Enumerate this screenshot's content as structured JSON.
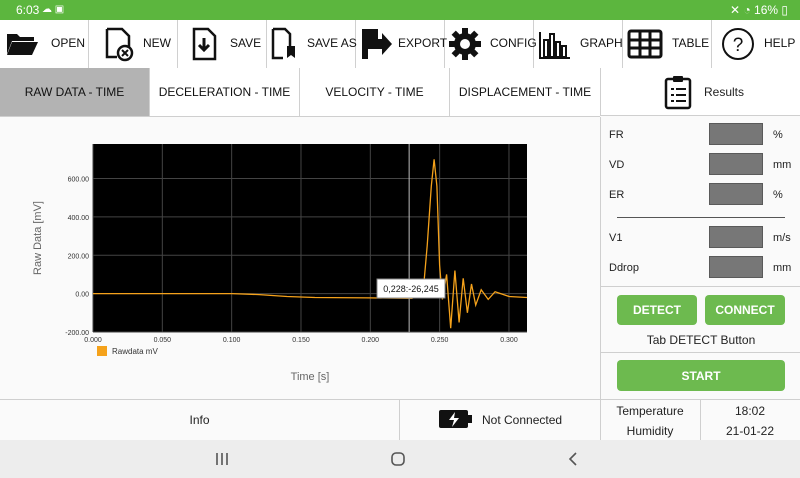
{
  "status_bar": {
    "time": "6:03",
    "battery": "16%"
  },
  "toolbar": [
    {
      "label": "OPEN",
      "icon": "folder-icon"
    },
    {
      "label": "NEW",
      "icon": "new-file-icon"
    },
    {
      "label": "SAVE",
      "icon": "save-icon"
    },
    {
      "label": "SAVE AS",
      "icon": "save-as-icon"
    },
    {
      "label": "EXPORT",
      "icon": "export-icon"
    },
    {
      "label": "CONFIG",
      "icon": "gear-icon"
    },
    {
      "label": "GRAPH",
      "icon": "bar-graph-icon"
    },
    {
      "label": "TABLE",
      "icon": "table-icon"
    },
    {
      "label": "HELP",
      "icon": "help-icon"
    }
  ],
  "tabs": [
    {
      "label": "RAW DATA - TIME",
      "active": true
    },
    {
      "label": "DECELERATION - TIME",
      "active": false
    },
    {
      "label": "VELOCITY - TIME",
      "active": false
    },
    {
      "label": "DISPLACEMENT - TIME",
      "active": false
    }
  ],
  "results": {
    "title": "Results",
    "fields": [
      {
        "key": "FR",
        "unit": "%",
        "value": ""
      },
      {
        "key": "VD",
        "unit": "mm",
        "value": ""
      },
      {
        "key": "ER",
        "unit": "%",
        "value": ""
      },
      {
        "key": "V1",
        "unit": "m/s",
        "value": ""
      },
      {
        "key": "Ddrop",
        "unit": "mm",
        "value": ""
      }
    ],
    "detect_label": "DETECT",
    "connect_label": "CONNECT",
    "hint": "Tab DETECT Button",
    "start_label": "START"
  },
  "bottom": {
    "info": "Info",
    "connection": "Not Connected",
    "temperature_label": "Temperature",
    "temperature_value": "18:02",
    "humidity_label": "Humidity",
    "humidity_value": "21-01-22"
  },
  "colors": {
    "accent": "#5cb63e",
    "button": "#6dba4f",
    "series": "#f5a21b",
    "plot_bg": "#000000"
  },
  "chart_data": {
    "type": "line",
    "xlabel": "Time [s]",
    "ylabel": "Raw Data [mV]",
    "xlim": [
      0.0,
      0.313
    ],
    "ylim": [
      -200,
      780
    ],
    "xticks": [
      "0.000",
      "0.050",
      "0.100",
      "0.150",
      "0.200",
      "0.250",
      "0.300"
    ],
    "yticks": [
      "-200.00",
      "0.00",
      "200.00",
      "400.00",
      "600.00"
    ],
    "grid": true,
    "legend": "bottom-left",
    "tooltip": "0,228:-26,245",
    "series": [
      {
        "name": "Rawdata mV",
        "x": [
          0.0,
          0.05,
          0.1,
          0.12,
          0.14,
          0.16,
          0.2,
          0.23,
          0.238,
          0.241,
          0.244,
          0.246,
          0.248,
          0.25,
          0.252,
          0.255,
          0.258,
          0.261,
          0.264,
          0.267,
          0.27,
          0.273,
          0.276,
          0.28,
          0.285,
          0.29,
          0.3,
          0.313
        ],
        "y": [
          0,
          0,
          0,
          -5,
          -15,
          -20,
          -22,
          -25,
          0,
          250,
          560,
          700,
          560,
          150,
          -30,
          100,
          -180,
          120,
          -150,
          80,
          -100,
          50,
          -60,
          20,
          -30,
          10,
          -15,
          -20
        ]
      }
    ]
  }
}
